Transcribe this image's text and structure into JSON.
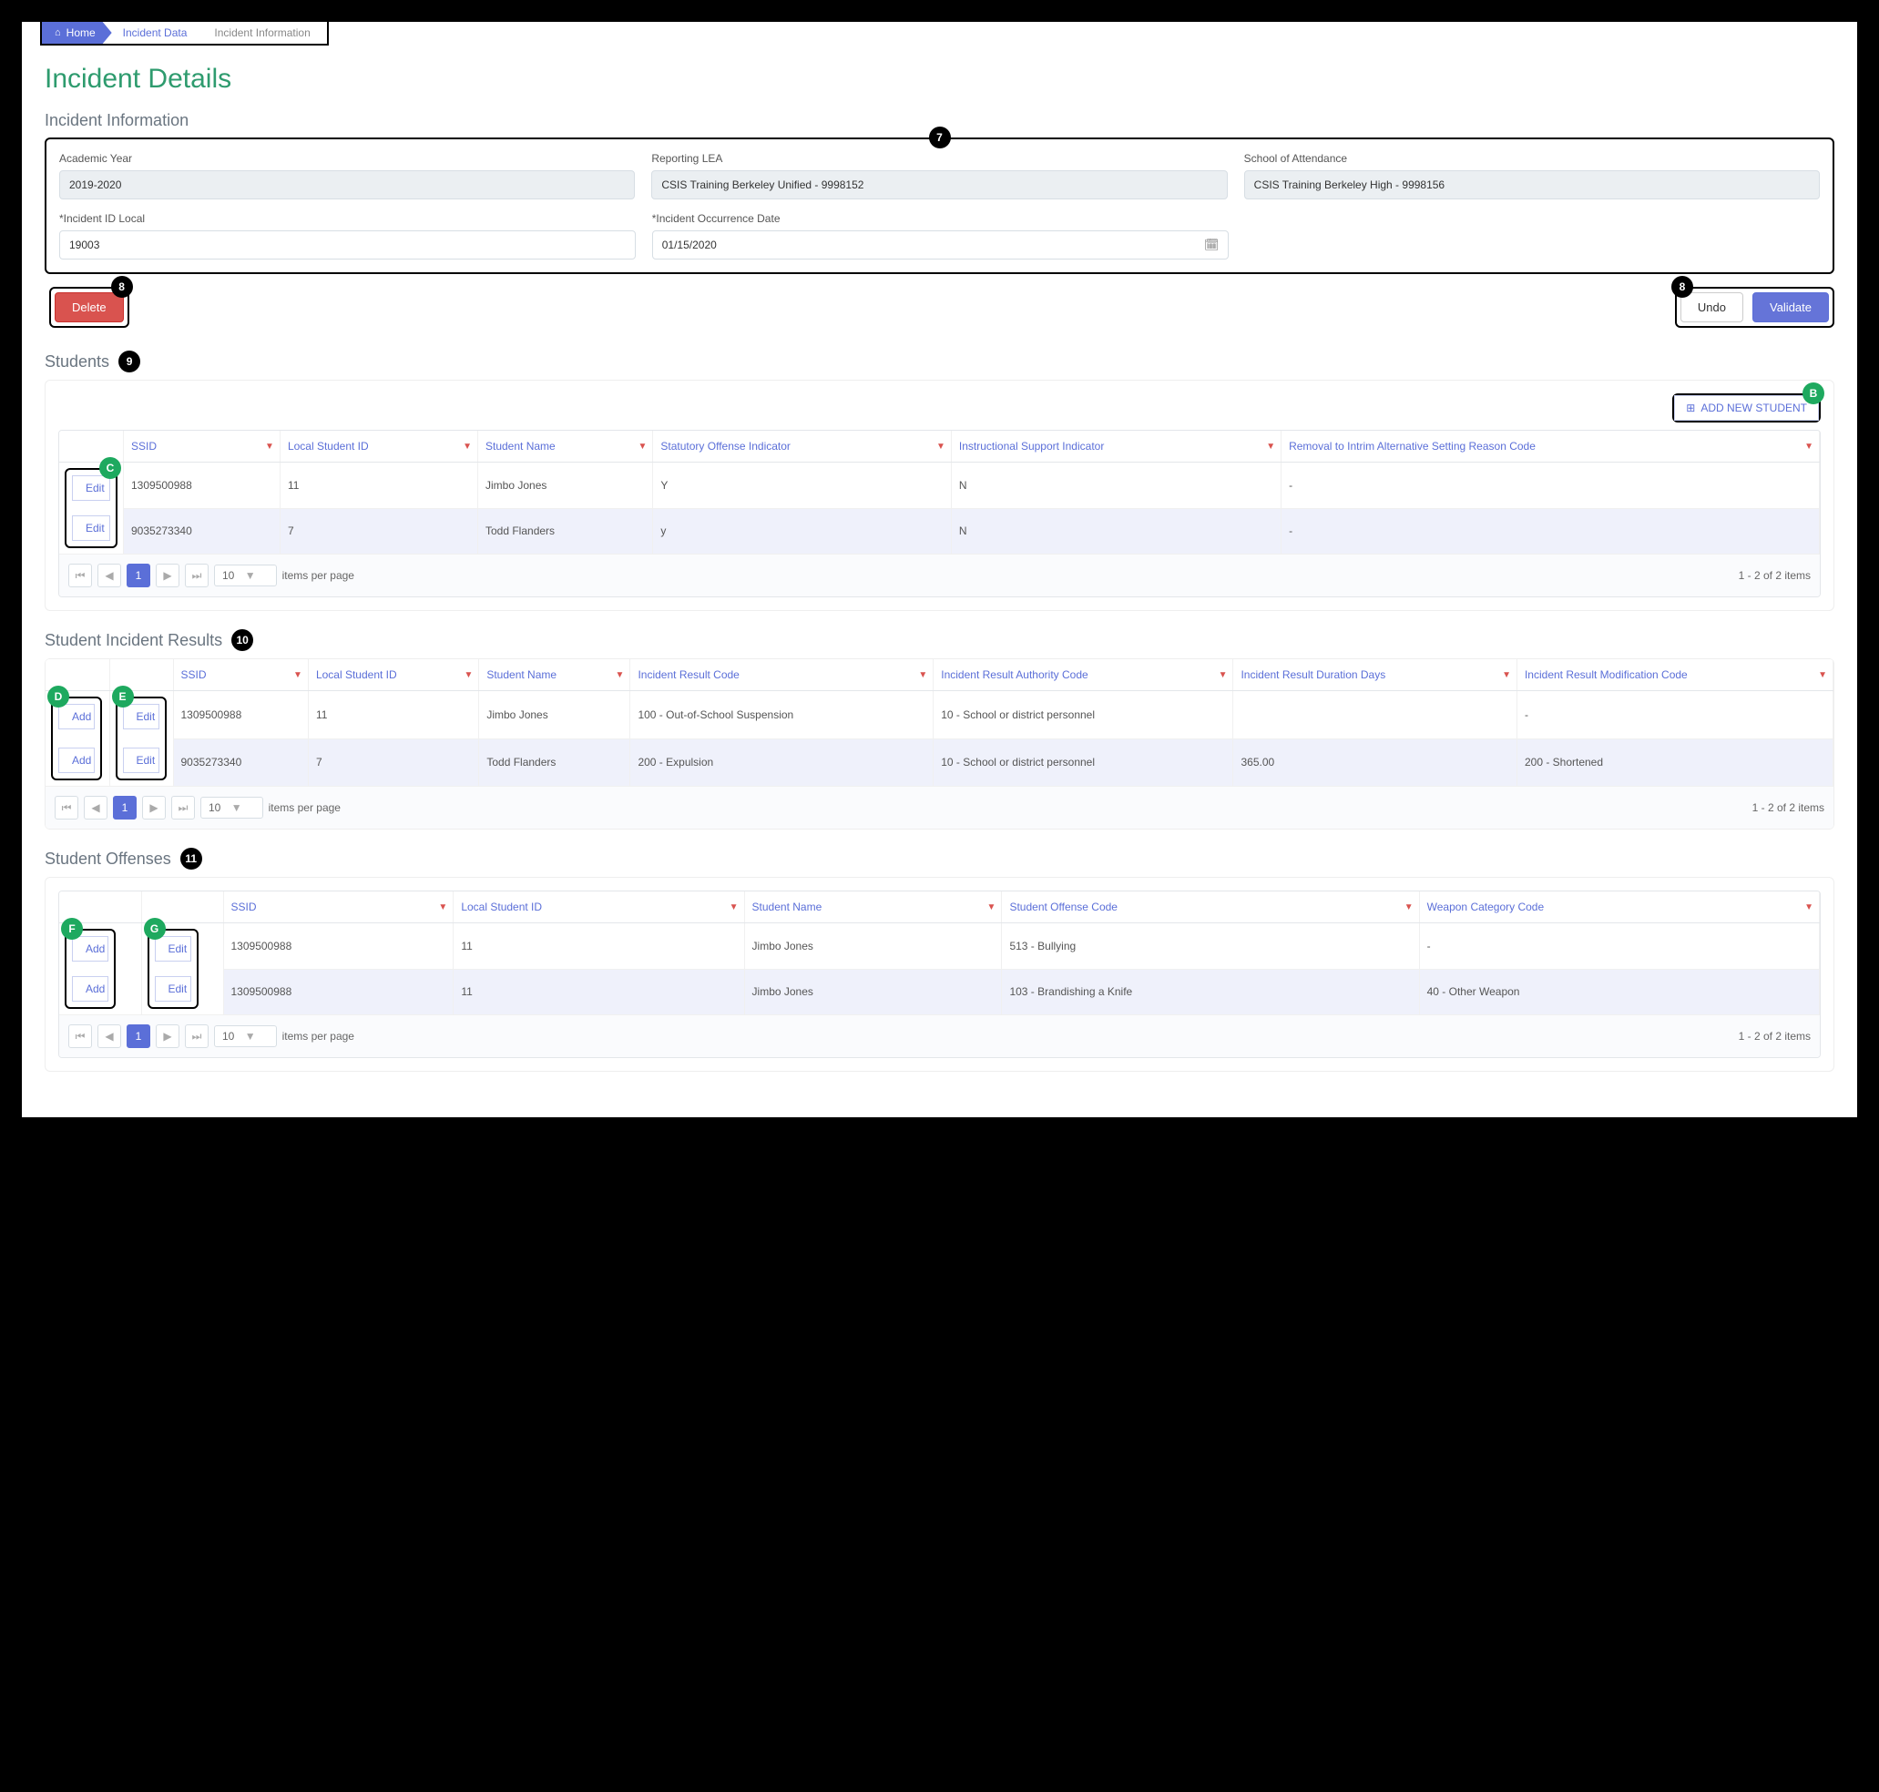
{
  "breadcrumb": {
    "home": "Home",
    "data": "Incident Data",
    "info": "Incident Information"
  },
  "title": "Incident Details",
  "section_info": "Incident Information",
  "fields": {
    "academic_year": {
      "label": "Academic Year",
      "value": "2019-2020"
    },
    "reporting_lea": {
      "label": "Reporting LEA",
      "value": "CSIS Training Berkeley Unified - 9998152"
    },
    "school": {
      "label": "School of Attendance",
      "value": "CSIS Training Berkeley High - 9998156"
    },
    "incident_id": {
      "label": "*Incident ID Local",
      "value": "19003"
    },
    "occurrence_date": {
      "label": "*Incident Occurrence Date",
      "value": "01/15/2020"
    }
  },
  "buttons": {
    "delete": "Delete",
    "undo": "Undo",
    "validate": "Validate",
    "add_student": "ADD NEW STUDENT",
    "edit": "Edit",
    "add": "Add"
  },
  "students": {
    "heading": "Students",
    "columns": [
      "SSID",
      "Local Student ID",
      "Student Name",
      "Statutory Offense Indicator",
      "Instructional Support Indicator",
      "Removal to Intrim Alternative Setting Reason Code"
    ],
    "rows": [
      {
        "ssid": "1309500988",
        "local": "11",
        "name": "Jimbo Jones",
        "soi": "Y",
        "isi": "N",
        "removal": "-"
      },
      {
        "ssid": "9035273340",
        "local": "7",
        "name": "Todd Flanders",
        "soi": "y",
        "isi": "N",
        "removal": "-"
      }
    ]
  },
  "results": {
    "heading": "Student Incident Results",
    "columns": [
      "SSID",
      "Local Student ID",
      "Student Name",
      "Incident Result Code",
      "Incident Result Authority Code",
      "Incident Result Duration Days",
      "Incident Result Modification Code"
    ],
    "rows": [
      {
        "ssid": "1309500988",
        "local": "11",
        "name": "Jimbo Jones",
        "result": "100 - Out-of-School Suspension",
        "authority": "10 - School or district personnel",
        "duration": "",
        "mod": "-"
      },
      {
        "ssid": "9035273340",
        "local": "7",
        "name": "Todd Flanders",
        "result": "200 - Expulsion",
        "authority": "10 - School or district personnel",
        "duration": "365.00",
        "mod": "200 - Shortened"
      }
    ]
  },
  "offenses": {
    "heading": "Student Offenses",
    "columns": [
      "SSID",
      "Local Student ID",
      "Student Name",
      "Student Offense Code",
      "Weapon Category Code"
    ],
    "rows": [
      {
        "ssid": "1309500988",
        "local": "11",
        "name": "Jimbo Jones",
        "offense": "513 - Bullying",
        "weapon": "-"
      },
      {
        "ssid": "1309500988",
        "local": "11",
        "name": "Jimbo Jones",
        "offense": "103 - Brandishing a Knife",
        "weapon": "40 - Other Weapon"
      }
    ]
  },
  "pager": {
    "page": "1",
    "per_page": "10",
    "label": "items per page",
    "summary": "1 - 2 of 2 items"
  },
  "callouts": {
    "panel": "7",
    "delete": "8",
    "undo": "8",
    "students": "9",
    "results": "10",
    "offenses": "11",
    "add_student": "B",
    "edit_student": "C",
    "add_result": "D",
    "edit_result": "E",
    "add_offense": "F",
    "edit_offense": "G"
  }
}
